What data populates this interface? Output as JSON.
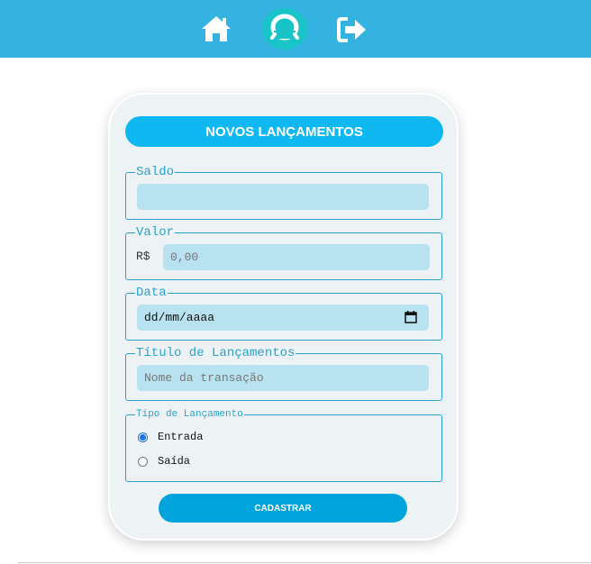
{
  "nav": {
    "icons": [
      "home-icon",
      "logo-icon",
      "logout-icon"
    ],
    "color": "#35b3e0"
  },
  "form": {
    "title": "NOVOS LANÇAMENTOS",
    "saldo": {
      "legend": "Saldo",
      "value": ""
    },
    "valor": {
      "legend": "Valor",
      "prefix": "R$",
      "placeholder": "0,00"
    },
    "data": {
      "legend": "Data",
      "placeholder": "dd/mm/aaaa"
    },
    "titulo": {
      "legend": "Título de Lançamentos",
      "placeholder": "Nome da transação"
    },
    "tipo": {
      "legend": "Tipo de Lançamento",
      "options": [
        {
          "label": "Entrada",
          "checked": true
        },
        {
          "label": "Saída",
          "checked": false
        }
      ]
    },
    "submit_label": "CADASTRAR"
  }
}
